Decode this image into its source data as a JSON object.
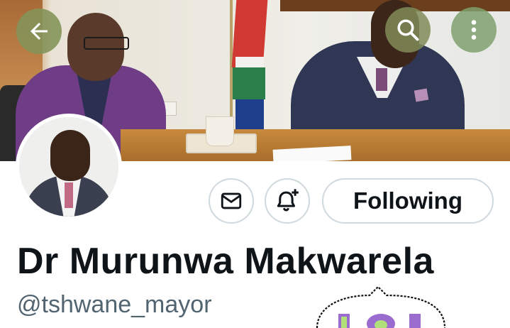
{
  "profile": {
    "name": "Dr Murunwa Makwarela",
    "handle": "@tshwane_mayor"
  },
  "actions": {
    "following_label": "Following"
  },
  "icons": {
    "back": "back-arrow-icon",
    "search": "search-icon",
    "more": "more-vertical-icon",
    "message": "envelope-icon",
    "notify": "bell-plus-icon"
  },
  "colors": {
    "text_primary": "#0f1419",
    "text_secondary": "#536471",
    "pill_border": "#cfd9de"
  }
}
